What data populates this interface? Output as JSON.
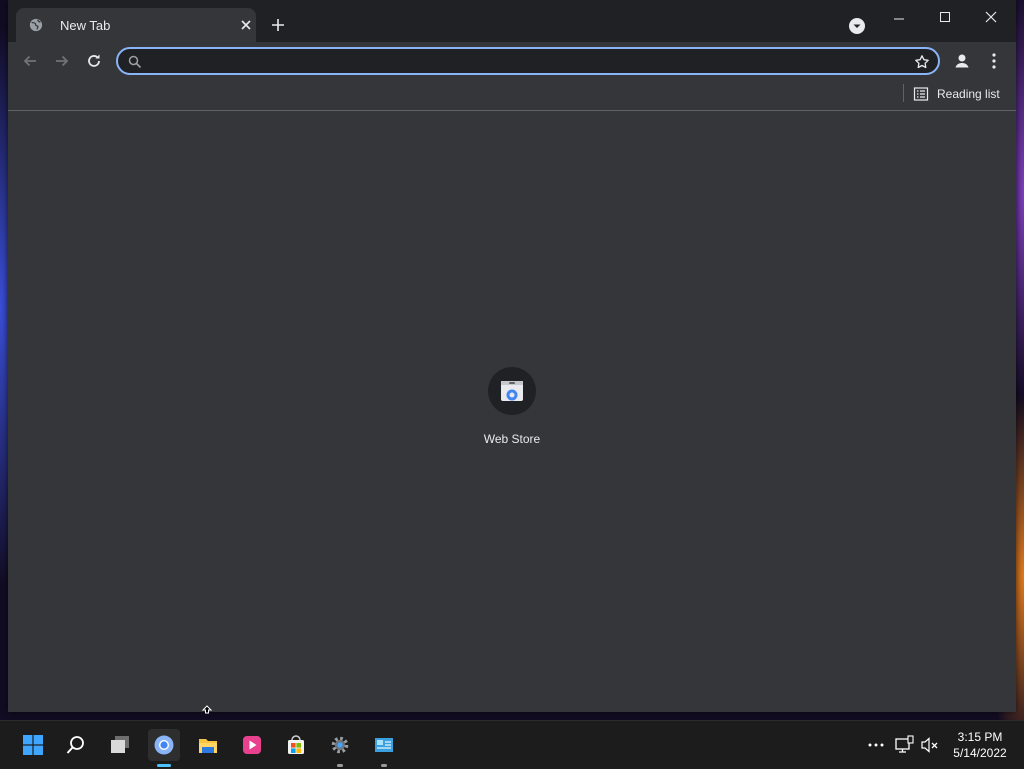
{
  "browser": {
    "tab": {
      "title": "New Tab"
    },
    "omnibox": {
      "value": "",
      "placeholder": ""
    },
    "bookmarks_bar": {
      "reading_list_label": "Reading list"
    },
    "new_tab_page": {
      "shortcuts": [
        {
          "label": "Web Store"
        }
      ]
    }
  },
  "taskbar": {
    "apps": [
      {
        "name": "start-button"
      },
      {
        "name": "search"
      },
      {
        "name": "task-view"
      },
      {
        "name": "chrome",
        "active": true
      },
      {
        "name": "file-explorer"
      },
      {
        "name": "media-player"
      },
      {
        "name": "microsoft-store"
      },
      {
        "name": "settings"
      },
      {
        "name": "control-panel"
      }
    ],
    "clock": {
      "time": "3:15 PM",
      "date": "5/14/2022"
    }
  },
  "colors": {
    "accent": "#8ab4f8",
    "window_bg": "#35363a",
    "tabstrip_bg": "#202124",
    "taskbar_bg": "#1c1c1c",
    "taskbar_active_indicator": "#4cc2ff"
  }
}
